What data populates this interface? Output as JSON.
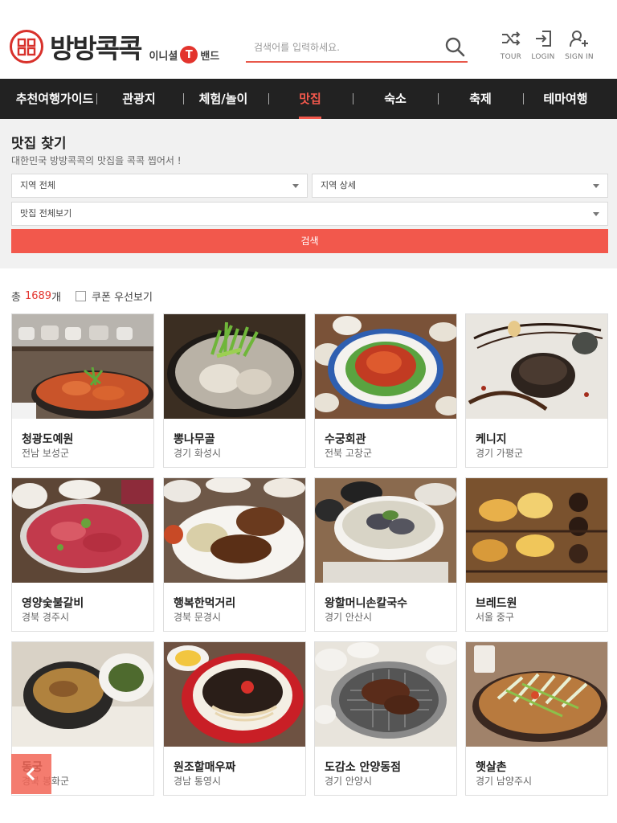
{
  "brand": {
    "logo_mark": "방방",
    "name": "방방콕콕",
    "sub_left": "이니셜",
    "sub_t": "T",
    "sub_right": "밴드",
    "accent_color": "#e3342d"
  },
  "search": {
    "placeholder": "검색어를 입력하세요.",
    "icon": "search-icon"
  },
  "utilities": [
    {
      "label": "TOUR",
      "icon": "shuffle-icon"
    },
    {
      "label": "LOGIN",
      "icon": "login-icon"
    },
    {
      "label": "SIGN IN",
      "icon": "user-plus-icon"
    }
  ],
  "nav": {
    "items": [
      {
        "label": "추천여행가이드"
      },
      {
        "label": "관광지"
      },
      {
        "label": "체험/놀이"
      },
      {
        "label": "맛집",
        "active": true
      },
      {
        "label": "숙소"
      },
      {
        "label": "축제"
      },
      {
        "label": "테마여행"
      }
    ]
  },
  "finder": {
    "title": "맛집 찾기",
    "description": "대한민국 방방콕콕의 맛집을 콕콕 찝어서 !",
    "region": "지역 전체",
    "region_detail": "지역 상세",
    "category": "맛집 전체보기",
    "submit": "검색"
  },
  "results": {
    "total_prefix": "총",
    "total_count": "1689",
    "total_suffix": "개",
    "coupon_label": "쿠폰 우선보기",
    "coupon_checked": false
  },
  "restaurants": [
    {
      "name": "청광도예원",
      "location": "전남 보성군"
    },
    {
      "name": "뽕나무골",
      "location": "경기 화성시"
    },
    {
      "name": "수궁회관",
      "location": "전북 고창군"
    },
    {
      "name": "케니지",
      "location": "경기 가평군"
    },
    {
      "name": "영양숯불갈비",
      "location": "경북 경주시"
    },
    {
      "name": "행복한먹거리",
      "location": "경북 문경시"
    },
    {
      "name": "왕할머니손칼국수",
      "location": "경기 안산시"
    },
    {
      "name": "브레드원",
      "location": "서울 중구"
    },
    {
      "name": "동궁",
      "location": "경북 봉화군"
    },
    {
      "name": "원조할매우짜",
      "location": "경남 통영시"
    },
    {
      "name": "도감소 안양동점",
      "location": "경기 안양시"
    },
    {
      "name": "햇살촌",
      "location": "경기 남양주시"
    }
  ],
  "prev_button": {
    "icon": "chevron-left-icon"
  }
}
